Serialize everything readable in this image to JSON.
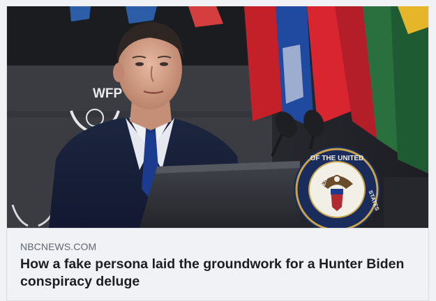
{
  "link_preview": {
    "image_description_icon": "photo",
    "image_text": {
      "wfp_label": "WFP",
      "seal_text_top": "OF THE UNITED",
      "seal_text_left": "PRESIDENT",
      "seal_text_right": "STATES"
    },
    "source": "NBCNEWS.COM",
    "headline": "How a fake persona laid the groundwork for a Hunter Biden conspiracy deluge"
  }
}
